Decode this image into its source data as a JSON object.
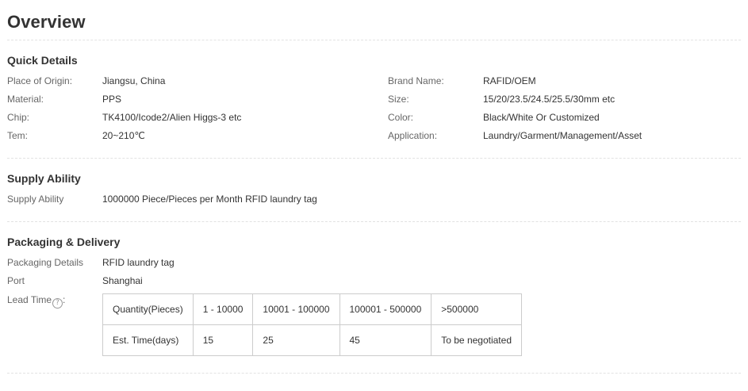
{
  "page_title": "Overview",
  "quick_details": {
    "title": "Quick Details",
    "left": [
      {
        "label": "Place of Origin:",
        "value": "Jiangsu, China"
      },
      {
        "label": "Material:",
        "value": "PPS"
      },
      {
        "label": "Chip:",
        "value": "TK4100/Icode2/Alien Higgs-3 etc"
      },
      {
        "label": "Tem:",
        "value": "20~210℃"
      }
    ],
    "right": [
      {
        "label": "Brand Name:",
        "value": "RAFID/OEM"
      },
      {
        "label": "Size:",
        "value": "15/20/23.5/24.5/25.5/30mm etc"
      },
      {
        "label": "Color:",
        "value": "Black/White Or Customized"
      },
      {
        "label": "Application:",
        "value": "Laundry/Garment/Management/Asset"
      }
    ]
  },
  "supply_ability": {
    "title": "Supply Ability",
    "label": "Supply Ability",
    "value": "1000000 Piece/Pieces per Month RFID laundry tag"
  },
  "packaging": {
    "title": "Packaging & Delivery",
    "details_label": "Packaging Details",
    "details_value": "RFID laundry tag",
    "port_label": "Port",
    "port_value": "Shanghai",
    "lead_time_label": "Lead Time",
    "help_icon": "question-circle-icon",
    "lead_table": {
      "rows": [
        [
          "Quantity(Pieces)",
          "1 - 10000",
          "10001 - 100000",
          "100001 - 500000",
          ">500000"
        ],
        [
          "Est. Time(days)",
          "15",
          "25",
          "45",
          "To be negotiated"
        ]
      ]
    }
  }
}
